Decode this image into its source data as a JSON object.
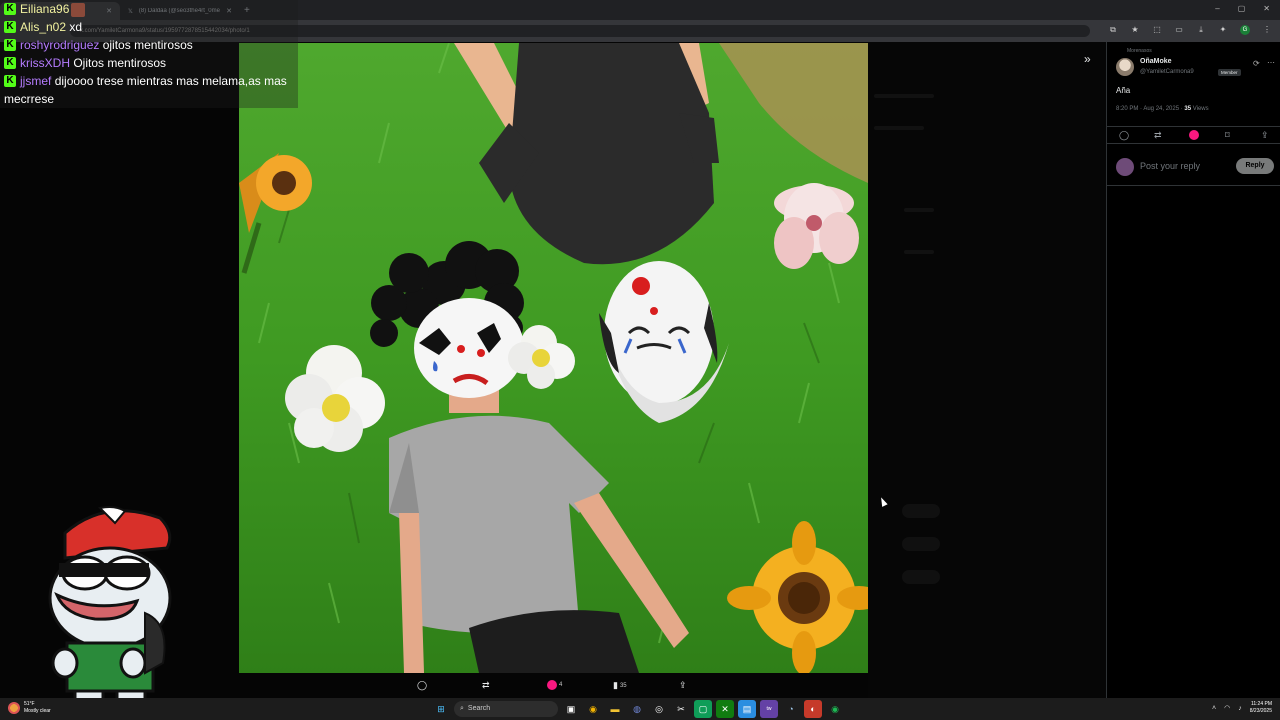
{
  "browser": {
    "tabs": [
      {
        "label": "",
        "active": true
      },
      {
        "label": "(8) Daldaa (@seo3the4rt_0me...",
        "active": false
      }
    ],
    "url": "x.com/YamiletCarmona9/status/1959772878515442034/photo/1"
  },
  "stream_chat": [
    {
      "user": "Eiliana96",
      "color": "#f2f2a0",
      "message": "",
      "has_emote": true
    },
    {
      "user": "Alis_n02",
      "color": "#f2f2a0",
      "message": "xd"
    },
    {
      "user": "roshyrodriguez",
      "color": "#b57cff",
      "message": "ojitos mentirosos"
    },
    {
      "user": "krissXDH",
      "color": "#b57cff",
      "message": "Ojitos mentirosos"
    },
    {
      "user": "jjsmef",
      "color": "#b57cff",
      "message": "dijoooo trese mientras mas melama,as mas mecrrese"
    }
  ],
  "lightbox": {
    "actions": {
      "likes": "4",
      "views": "35"
    }
  },
  "post": {
    "community": "Morenasos",
    "display_name": "OñaMoke",
    "handle": "@YamiletCarmona9",
    "badge": "Member",
    "text": "Aña",
    "time": "8:20 PM · Aug 24, 2025 · ",
    "views": "35",
    "views_label": " Views",
    "reply_placeholder": "Post your reply",
    "reply_button": "Reply"
  },
  "taskbar": {
    "weather_temp": "51°F",
    "weather_desc": "Mostly clear",
    "search_label": "Search",
    "time": "11:24 PM",
    "date": "8/23/2025"
  },
  "colors": {
    "accent_pink": "#f91880",
    "kick_green": "#53fc18"
  }
}
